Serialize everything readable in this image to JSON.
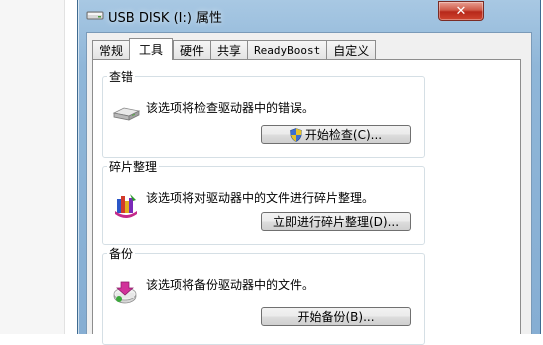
{
  "window": {
    "title": "USB DISK (I:) 属性",
    "close_glyph": "✕"
  },
  "tabs": [
    {
      "label": "常规"
    },
    {
      "label": "工具"
    },
    {
      "label": "硬件"
    },
    {
      "label": "共享"
    },
    {
      "label": "ReadyBoost"
    },
    {
      "label": "自定义"
    }
  ],
  "active_tab": "工具",
  "groups": {
    "error_check": {
      "title": "查错",
      "description": "该选项将检查驱动器中的错误。",
      "button": "开始检查(C)...",
      "icon": "disk-drive-icon"
    },
    "defrag": {
      "title": "碎片整理",
      "description": "该选项将对驱动器中的文件进行碎片整理。",
      "button": "立即进行碎片整理(D)...",
      "icon": "defrag-icon"
    },
    "backup": {
      "title": "备份",
      "description": "该选项将备份驱动器中的文件。",
      "button": "开始备份(B)...",
      "icon": "backup-icon"
    }
  },
  "colors": {
    "titlebar": "#8fb6d8",
    "close_button": "#c43c2a",
    "page_background": "#ffffff"
  }
}
